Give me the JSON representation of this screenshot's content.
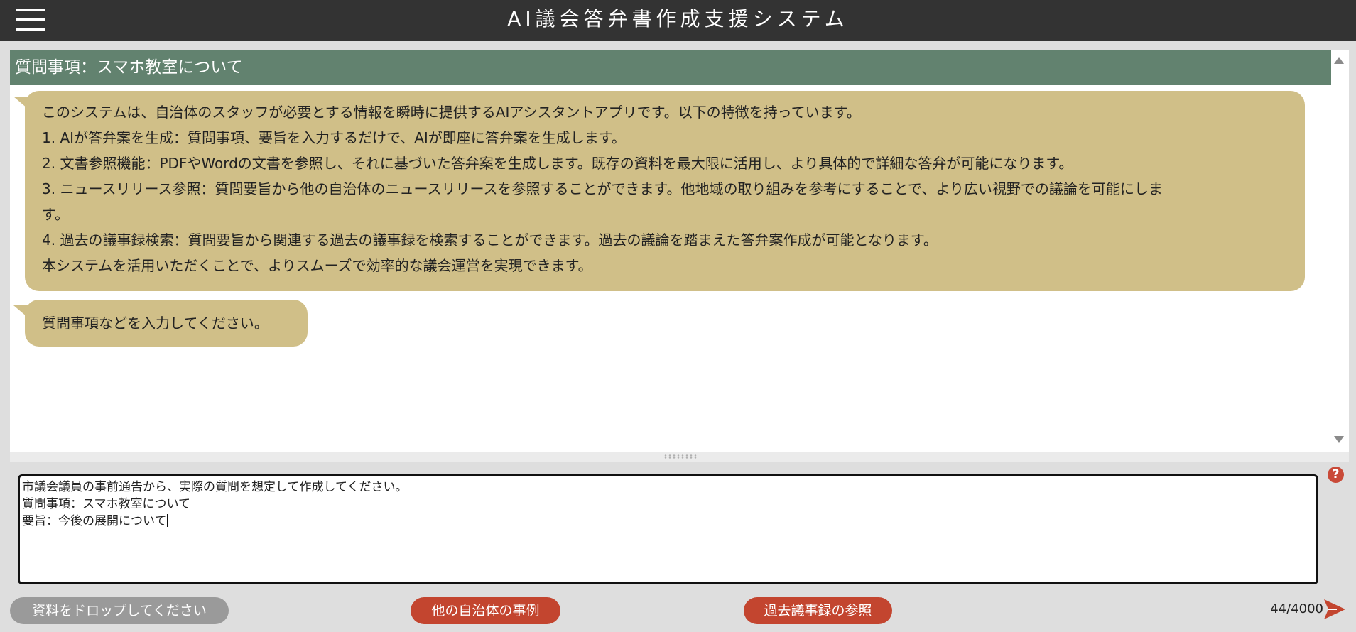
{
  "header": {
    "menu_icon": "hamburger-menu-icon",
    "title": "AI議会答弁書作成支援システム"
  },
  "chat": {
    "subject": "質問事項：スマホ教室について",
    "messages": [
      {
        "role": "assistant",
        "lines": [
          "このシステムは、自治体のスタッフが必要とする情報を瞬時に提供するAIアシスタントアプリです。以下の特徴を持っています。",
          "1. AIが答弁案を生成：質問事項、要旨を入力するだけで、AIが即座に答弁案を生成します。",
          "2. 文書参照機能：PDFやWordの文書を参照し、それに基づいた答弁案を生成します。既存の資料を最大限に活用し、より具体的で詳細な答弁が可能になります。",
          "3. ニュースリリース参照：質問要旨から他の自治体のニュースリリースを参照することができます。他地域の取り組みを参考にすることで、より広い視野での議論を可能にしま",
          "す。",
          "4. 過去の議事録検索：質問要旨から関連する過去の議事録を検索することができます。過去の議論を踏まえた答弁案作成が可能となります。",
          "本システムを活用いただくことで、よりスムーズで効率的な議会運営を実現できます。"
        ]
      },
      {
        "role": "assistant",
        "lines": [
          "質問事項などを入力してください。"
        ]
      }
    ]
  },
  "input": {
    "lines": [
      "市議会議員の事前通告から、実際の質問を想定して作成してください。",
      "質問事項：スマホ教室について",
      "要旨：今後の展開について"
    ],
    "help_icon": "help-icon",
    "help_symbol": "?"
  },
  "footer": {
    "drop_label": "資料をドロップしてください",
    "other_municipalities_label": "他の自治体の事例",
    "past_minutes_label": "過去議事録の参照",
    "char_count": "44/4000",
    "send_icon": "send-icon"
  },
  "colors": {
    "header_bg": "#333333",
    "subject_bar": "#62826f",
    "bubble": "#d0bf88",
    "accent_button": "#c3452f",
    "drop_button": "#9a9a9a",
    "help": "#c94a38"
  }
}
